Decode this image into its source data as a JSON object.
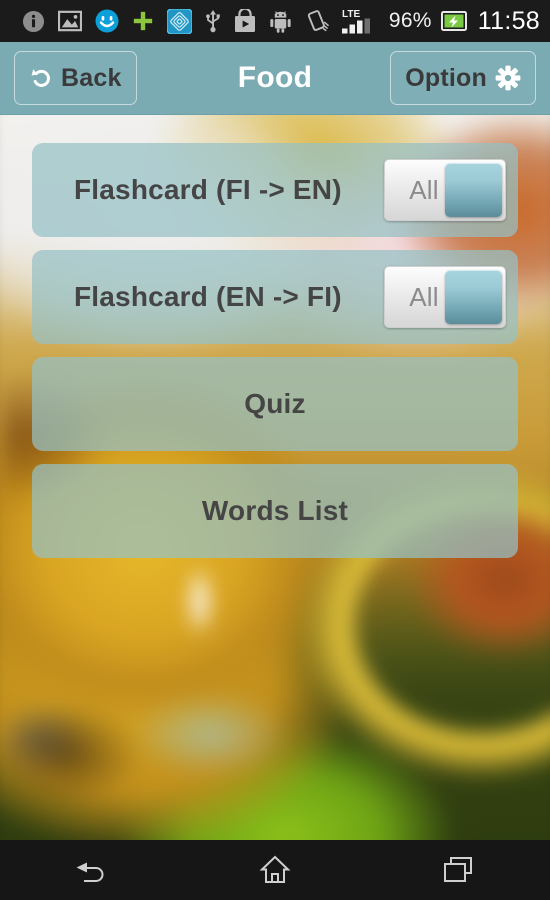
{
  "status_bar": {
    "icons": [
      {
        "name": "info-icon"
      },
      {
        "name": "screenshot-image-icon"
      },
      {
        "name": "smiley-face-icon"
      },
      {
        "name": "plus-icon"
      },
      {
        "name": "app-tile-icon"
      },
      {
        "name": "usb-icon"
      },
      {
        "name": "play-store-bag-icon"
      },
      {
        "name": "android-robot-icon"
      },
      {
        "name": "auto-rotate-off-icon"
      }
    ],
    "network_label": "LTE",
    "battery_percent": "96%",
    "clock": "11:58",
    "background_color": "#1b1b1b"
  },
  "action_bar": {
    "back_label": "Back",
    "title": "Food",
    "option_label": "Option",
    "background_color": "#7aabb3",
    "title_color": "#ffffff",
    "label_color": "#3a3a3a"
  },
  "menu": {
    "items": [
      {
        "label": "Flashcard (FI -> EN)",
        "toggle": {
          "label": "All",
          "state": "on"
        }
      },
      {
        "label": "Flashcard (EN -> FI)",
        "toggle": {
          "label": "All",
          "state": "on"
        }
      },
      {
        "label": "Quiz",
        "toggle": null
      },
      {
        "label": "Words List",
        "toggle": null
      }
    ],
    "button_color": "#96c1c5",
    "text_color": "#454545"
  },
  "nav_bar": {
    "buttons": [
      {
        "name": "back-nav-icon"
      },
      {
        "name": "home-nav-icon"
      },
      {
        "name": "recents-nav-icon"
      }
    ],
    "background_color": "#161616"
  }
}
